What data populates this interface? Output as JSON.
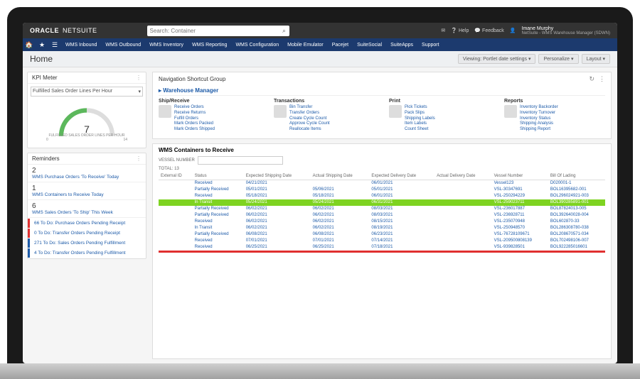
{
  "header": {
    "brand": "ORACLE",
    "brand_sub": "NETSUITE",
    "search_placeholder": "Search: Container",
    "help": "Help",
    "feedback": "Feedback",
    "user_name": "Imane Murphy",
    "user_role": "NetSuite - WMS Warehouse Manager (SDWN)"
  },
  "nav": [
    "WMS Inbound",
    "WMS Outbound",
    "WMS Inventory",
    "WMS Reporting",
    "WMS Configuration",
    "Mobile Emulator",
    "Pacejet",
    "SuiteSocial",
    "SuiteApps",
    "Support"
  ],
  "page": {
    "title": "Home",
    "viewing": "Viewing: Portlet date settings ▾",
    "personalize": "Personalize ▾",
    "layout": "Layout ▾"
  },
  "kpi": {
    "title": "KPI Meter",
    "selector": "Fulfilled Sales Order Lines Per Hour",
    "value": "7",
    "label": "FULFILLED SALES ORDER LINES PER HOUR",
    "min": "0",
    "max": "14"
  },
  "reminders": {
    "title": "Reminders",
    "items": [
      {
        "n": "2",
        "t": "WMS Purchase Orders 'To Receive' Today"
      },
      {
        "n": "1",
        "t": "WMS Containers to Receive Today"
      },
      {
        "n": "6",
        "t": "WMS Sales Orders 'To Ship' This Week"
      }
    ],
    "todos": [
      {
        "c": "#e03030",
        "t": "66 To Do: Purchase Orders Pending Receipt"
      },
      {
        "c": "#e03030",
        "t": "0 To Do: Transfer Orders Pending Receipt"
      },
      {
        "c": "#1c5aa8",
        "t": "271 To Do: Sales Orders Pending Fulfillment"
      },
      {
        "c": "#1c5aa8",
        "t": "4 To Do: Transfer Orders Pending Fulfillment"
      }
    ]
  },
  "shortcuts": {
    "title": "Navigation Shortcut Group",
    "section": "Warehouse Manager",
    "cols": [
      {
        "h": "Ship/Receive",
        "links": [
          "Receive Orders",
          "Receive Returns",
          "Fulfill Orders",
          "Mark Orders Packed",
          "Mark Orders Shipped"
        ]
      },
      {
        "h": "Transactions",
        "links": [
          "Bin Transfer",
          "Transfer Orders",
          "Create Cycle Count",
          "Approve Cycle Count",
          "Reallocate Items"
        ]
      },
      {
        "h": "Print",
        "links": [
          "Pick Tickets",
          "Pack Slips",
          "Shipping Labels",
          "Item Labels",
          "Count Sheet"
        ]
      },
      {
        "h": "Reports",
        "links": [
          "Inventory Backorder",
          "Inventory Turnover",
          "Inventory Status",
          "Shipping Analysis",
          "Shipping Report"
        ]
      }
    ]
  },
  "table": {
    "title": "WMS Containers to Receive",
    "vessel_label": "VESSEL NUMBER",
    "total": "TOTAL: 13",
    "headers": [
      "External ID",
      "Status",
      "Expected Shipping Date",
      "Actual Shipping Date",
      "Expected Delivery Date",
      "Actual Delivery Date",
      "Vessel Number",
      "Bill Of Lading"
    ],
    "rows": [
      {
        "cls": "",
        "c": [
          "",
          "Received",
          "04/21/2021",
          "",
          "06/01/2021",
          "",
          "Vessel123",
          "D020001-1"
        ]
      },
      {
        "cls": "",
        "c": [
          "",
          "Partially Received",
          "05/01/2021",
          "05/06/2021",
          "05/01/2021",
          "",
          "VSL-30347691",
          "BOL16395682-001"
        ]
      },
      {
        "cls": "",
        "c": [
          "",
          "Received",
          "05/18/2021",
          "05/18/2021",
          "06/01/2021",
          "",
          "VSL-250294229",
          "BOL296024921-003"
        ]
      },
      {
        "cls": "g",
        "c": [
          "",
          "In Transit",
          "05/24/2021",
          "05/24/2021",
          "06/31/2021",
          "",
          "VSL-259023711",
          "BOL390285891-001"
        ]
      },
      {
        "cls": "",
        "c": [
          "",
          "Partially Received",
          "06/02/2021",
          "06/02/2021",
          "08/03/2021",
          "",
          "VSL-236017887",
          "BOL87824013-005"
        ]
      },
      {
        "cls": "",
        "c": [
          "",
          "Partially Received",
          "06/02/2021",
          "06/02/2021",
          "08/03/2021",
          "",
          "VSL-236928711",
          "BOL392640028-004"
        ]
      },
      {
        "cls": "",
        "c": [
          "",
          "Received",
          "06/02/2021",
          "06/02/2021",
          "08/15/2021",
          "",
          "VSL-235070948",
          "BOL602870-33"
        ]
      },
      {
        "cls": "",
        "c": [
          "",
          "In Transit",
          "06/02/2021",
          "06/02/2021",
          "08/19/2021",
          "",
          "VSL-250948570",
          "BOL286308780-038"
        ]
      },
      {
        "cls": "",
        "c": [
          "",
          "Partially Received",
          "06/08/2021",
          "06/08/2021",
          "06/23/2021",
          "",
          "VSL-76728109671",
          "BOL208670571-034"
        ]
      },
      {
        "cls": "",
        "c": [
          "",
          "Received",
          "07/01/2021",
          "07/01/2021",
          "07/14/2021",
          "",
          "VSL-209500808139",
          "BOL702498106-007"
        ]
      },
      {
        "cls": "",
        "c": [
          "",
          "Received",
          "06/25/2021",
          "06/25/2021",
          "07/18/2021",
          "",
          "VSL-939828501",
          "BOL922285016601"
        ]
      },
      {
        "cls": "r",
        "c": [
          "",
          "",
          "",
          "",
          "",
          "",
          "",
          ""
        ]
      }
    ]
  }
}
